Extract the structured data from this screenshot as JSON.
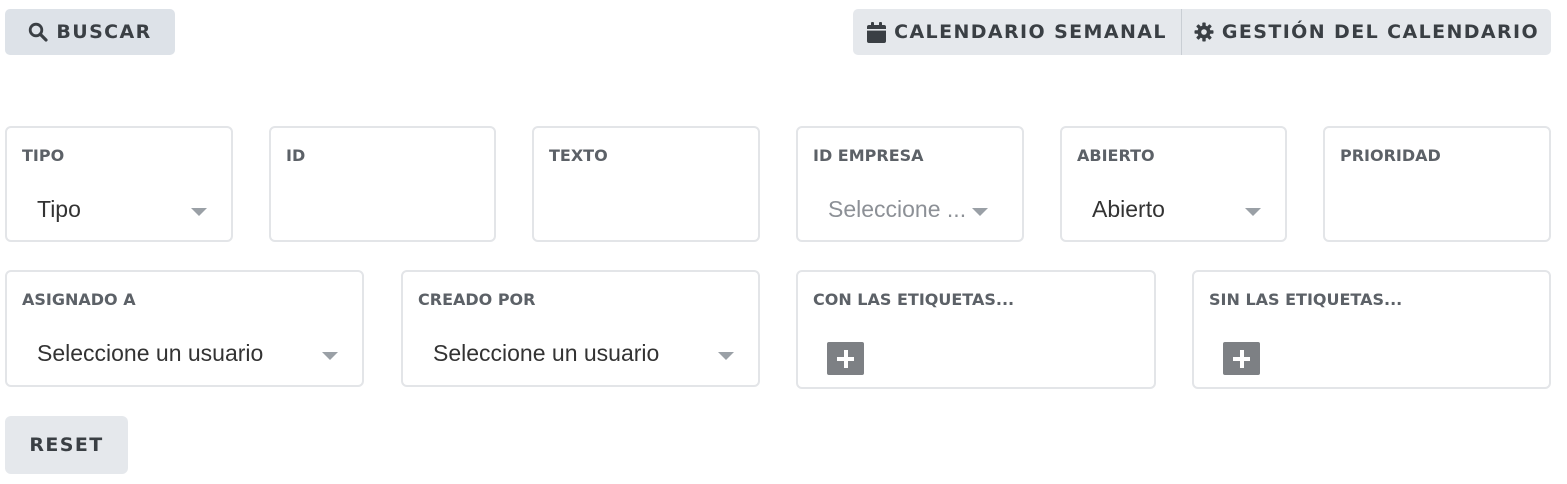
{
  "toolbar": {
    "search_label": "BUSCAR",
    "weekly_calendar_label": "CALENDARIO SEMANAL",
    "calendar_management_label": "GESTIÓN DEL CALENDARIO"
  },
  "filters": {
    "tipo": {
      "label": "TIPO",
      "value": "Tipo"
    },
    "id": {
      "label": "ID",
      "value": ""
    },
    "texto": {
      "label": "TEXTO",
      "value": ""
    },
    "id_empresa": {
      "label": "ID EMPRESA",
      "placeholder": "Seleccione ..."
    },
    "abierto": {
      "label": "ABIERTO",
      "value": "Abierto"
    },
    "prioridad": {
      "label": "PRIORIDAD",
      "value": ""
    },
    "asignado_a": {
      "label": "ASIGNADO A",
      "value": "Seleccione un usuario"
    },
    "creado_por": {
      "label": "CREADO POR",
      "value": "Seleccione un usuario"
    },
    "con_etiquetas": {
      "label": "CON LAS ETIQUETAS..."
    },
    "sin_etiquetas": {
      "label": "SIN LAS ETIQUETAS..."
    }
  },
  "reset_label": "RESET",
  "icons": {
    "search": "search-icon",
    "calendar": "calendar-icon",
    "gear": "gear-icon",
    "plus": "plus-icon",
    "caret": "chevron-down-icon"
  },
  "colors": {
    "button_bg": "#dde2e8",
    "group_bg": "#e5e8ec",
    "card_border": "#e3e5e8",
    "plus_bg": "#7d8084"
  }
}
